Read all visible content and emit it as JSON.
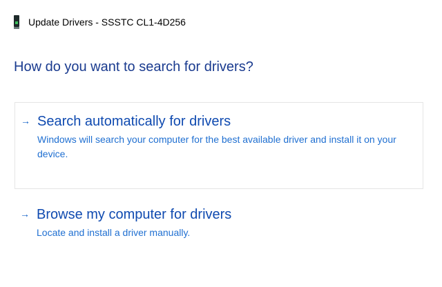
{
  "window": {
    "title": "Update Drivers - SSSTC CL1-4D256",
    "icon": "storage-device-icon"
  },
  "page": {
    "heading": "How do you want to search for drivers?"
  },
  "options": [
    {
      "arrow": "→",
      "title": "Search automatically for drivers",
      "description": "Windows will search your computer for the best available driver and install it on your device."
    },
    {
      "arrow": "→",
      "title": "Browse my computer for drivers",
      "description": "Locate and install a driver manually."
    }
  ],
  "colors": {
    "heading": "#1a3b8f",
    "option_title": "#0f4ab0",
    "option_description": "#1f6fd1",
    "option_border": "#e5e5e5"
  }
}
